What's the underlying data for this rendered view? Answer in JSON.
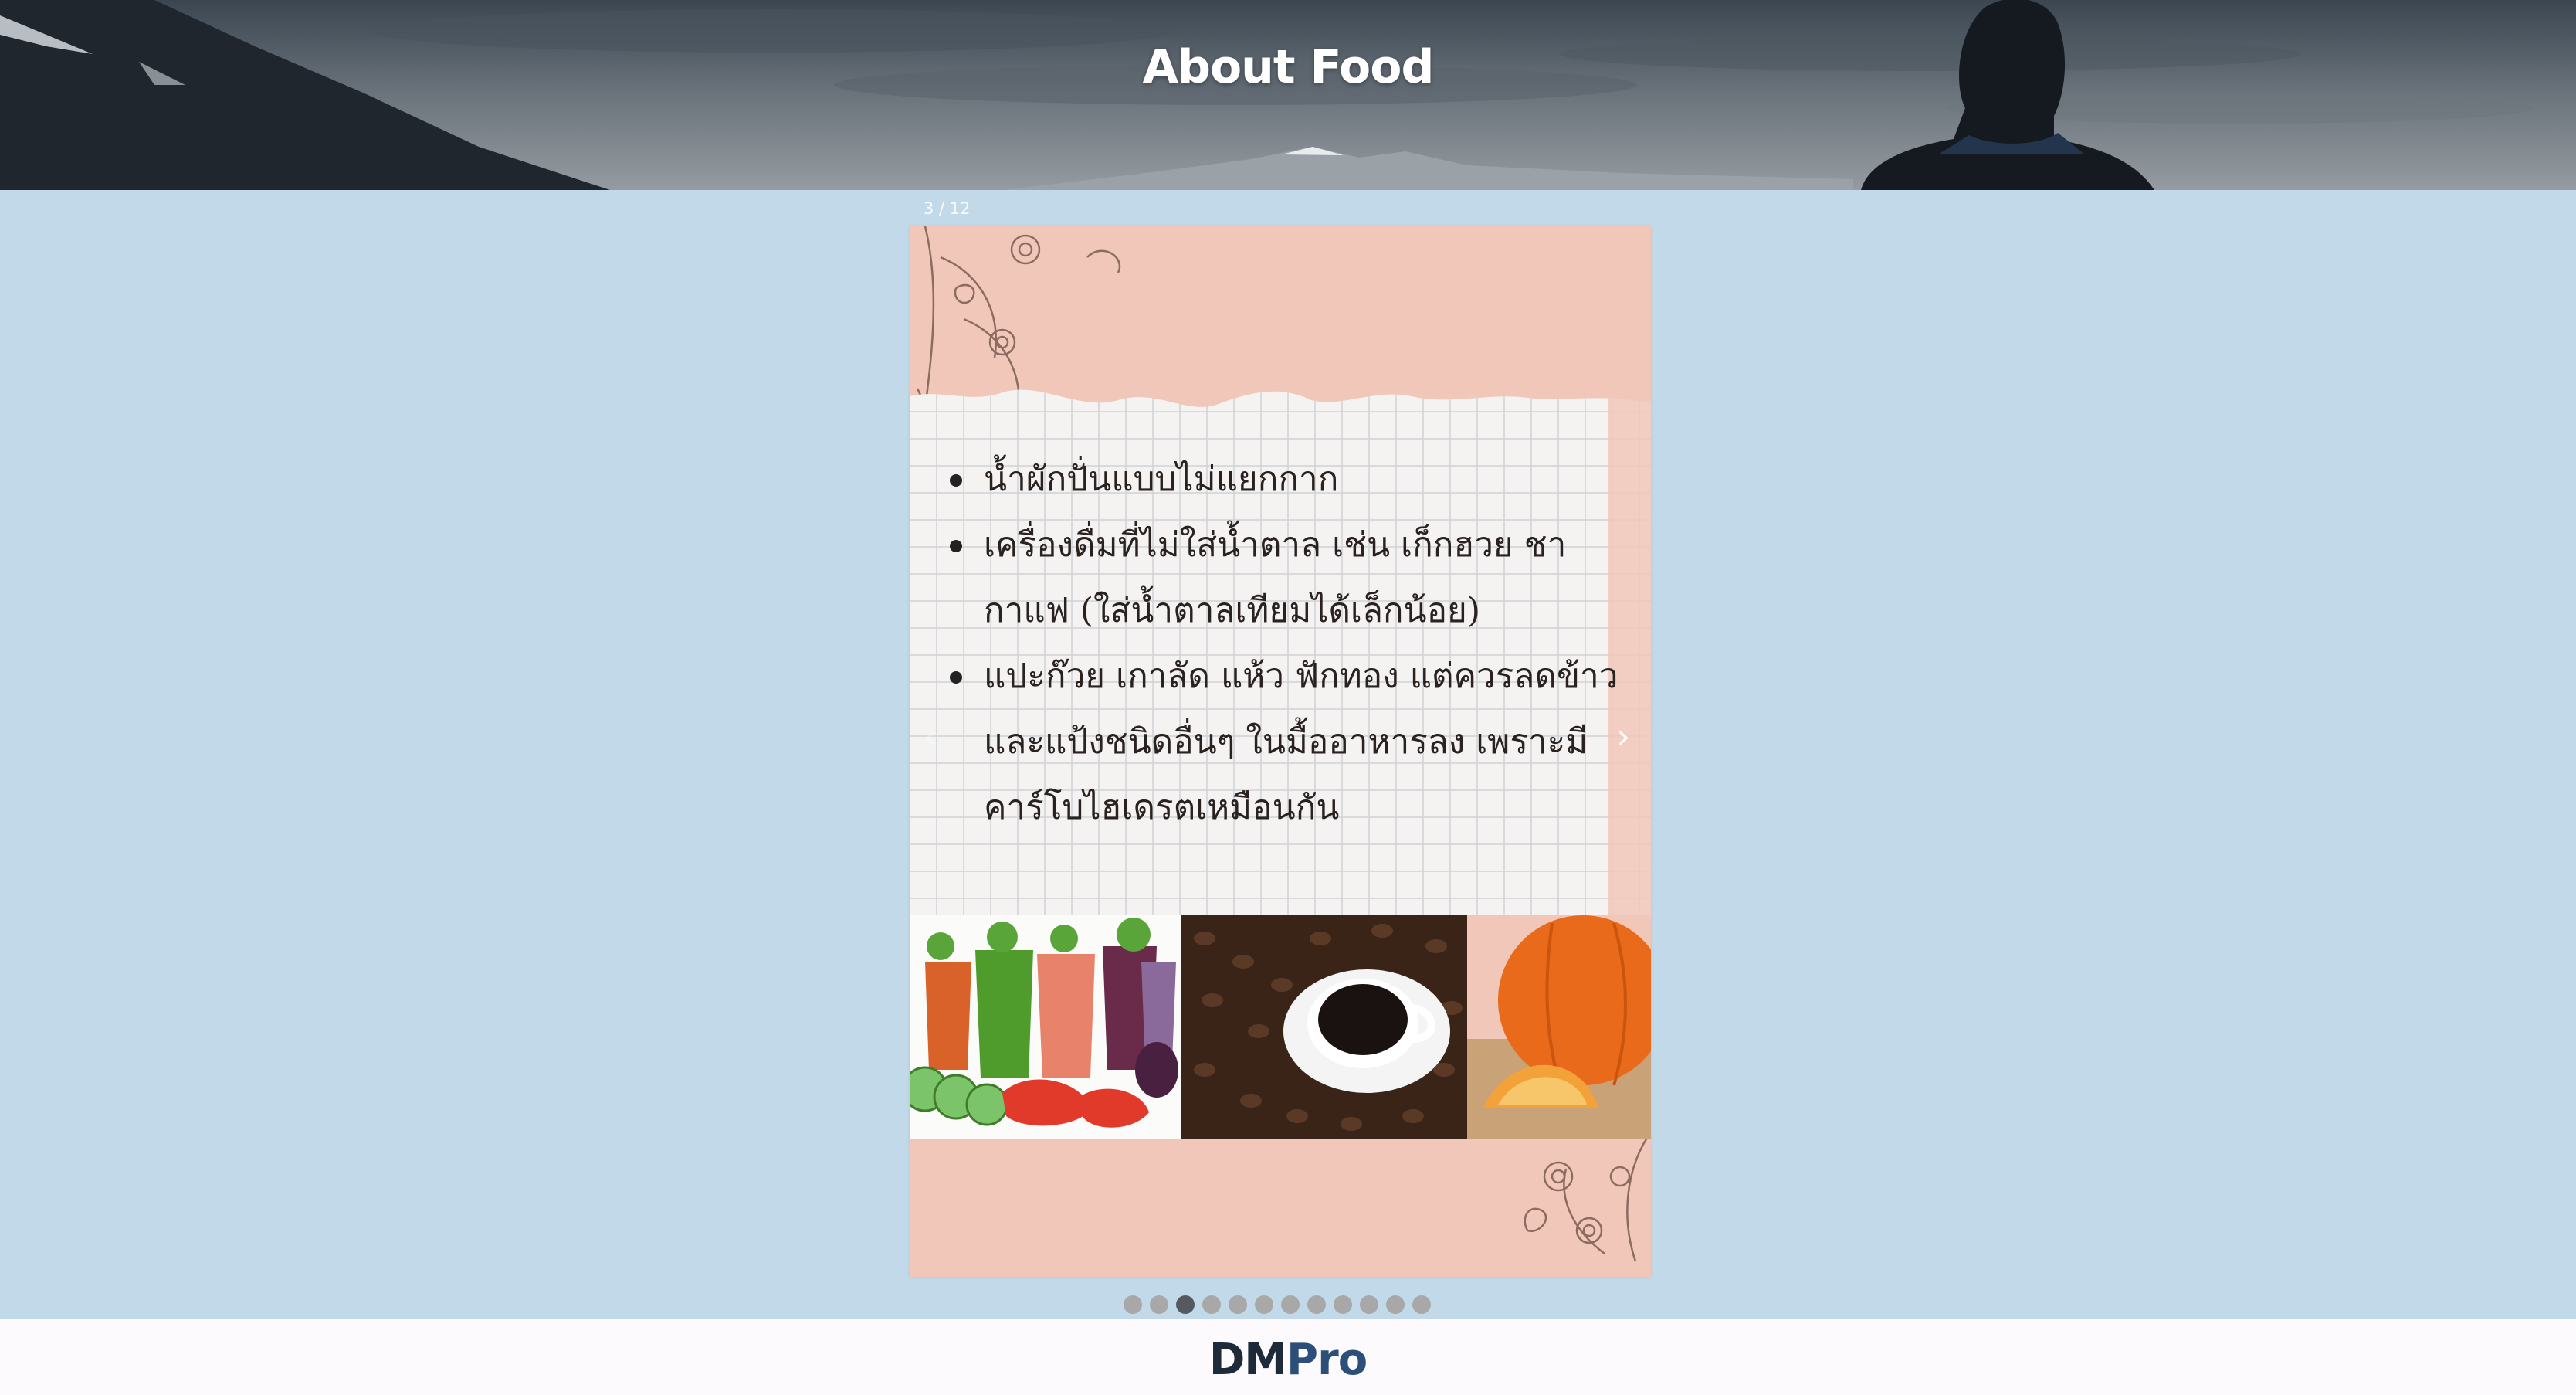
{
  "header": {
    "title": "About Food"
  },
  "slideshow": {
    "counter": "3 / 12",
    "prev_label": "‹",
    "next_label": "›",
    "slide": {
      "bullets": [
        "น้ำผักปั่นแบบไม่แยกกาก",
        "เครื่องดื่มที่ไม่ใส่น้ำตาล เช่น เก็กฮวย ชา กาแฟ (ใส่น้ำตาลเทียมได้เล็กน้อย)",
        "แปะก๊วย เกาลัด แห้ว ฟักทอง แต่ควรลดข้าวและแป้งชนิดอื่นๆ ในมื้ออาหารลง เพราะมีคาร์โบไฮเดรตเหมือนกัน"
      ],
      "photos": [
        "vegetable-juice-image",
        "coffee-image",
        "pumpkin-image"
      ]
    },
    "total_slides": 12,
    "active_index": 3
  },
  "footer": {
    "brand_part1": "DM",
    "brand_part2": "Pro"
  },
  "colors": {
    "page_background": "#c1d9e8",
    "slide_background": "#f0c7b8",
    "dot_inactive": "#a8a8a8",
    "dot_active": "#555a5e",
    "brand_dark": "#1c2a3a",
    "brand_blue": "#2b4f78"
  }
}
